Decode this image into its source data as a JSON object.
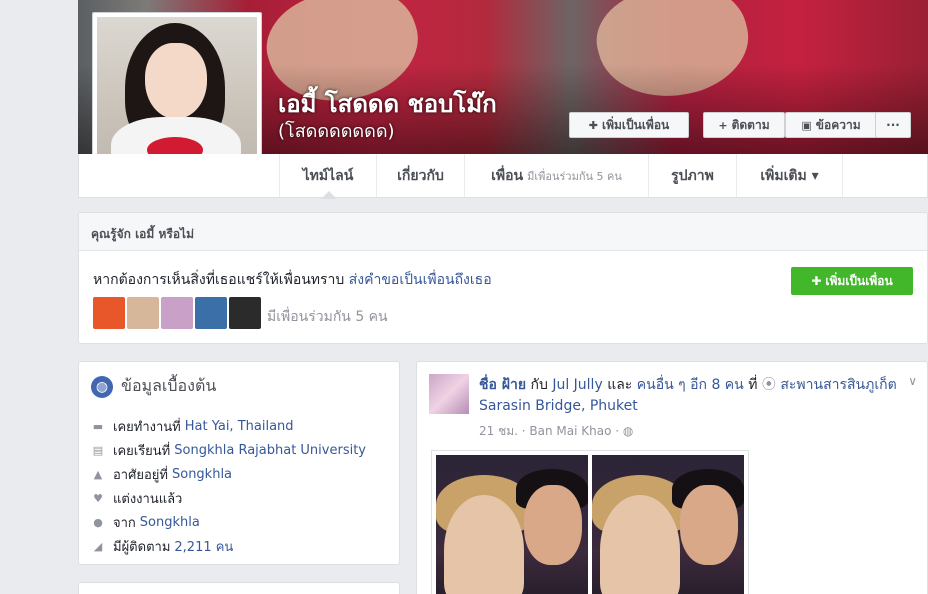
{
  "profile": {
    "name": "เอมี้ โสดดด ชอบโม๊ก",
    "alternate_name": "(โสดดดดดดด)"
  },
  "cover_actions": {
    "add_friend": "เพิ่มเป็นเพื่อน",
    "follow": "ติดตาม",
    "message": "ข้อความ",
    "more": "···"
  },
  "tabs": {
    "timeline": "ไทม์ไลน์",
    "about": "เกี่ยวกับ",
    "friends": "เพื่อน",
    "friends_sub": "มีเพื่อนร่วมกัน 5 คน",
    "photos": "รูปภาพ",
    "more": "เพิ่มเติม ▾"
  },
  "know_box": {
    "header": "คุณรู้จัก เอมี้ หรือไม่",
    "message": "หากต้องการเห็นสิ่งที่เธอแชร์ให้เพื่อนทราบ",
    "message_link": "ส่งคำขอเป็นเพื่อนถึงเธอ",
    "add_button": "เพิ่มเป็นเพื่อน",
    "mutual_text": "มีเพื่อนร่วมกัน 5 คน",
    "thumb_colors": [
      "#e8572a",
      "#d6b79a",
      "#c8a0c8",
      "#3a6fa8",
      "#2b2b2b"
    ]
  },
  "intro": {
    "title": "ข้อมูลเบื้องต้น",
    "rows": [
      {
        "icon": "briefcase-icon",
        "glyph": "▬",
        "label": "เคยทำงานที่",
        "value": "Hat Yai, Thailand"
      },
      {
        "icon": "school-icon",
        "glyph": "▤",
        "label": "เคยเรียนที่",
        "value": "Songkhla Rajabhat University"
      },
      {
        "icon": "home-icon",
        "glyph": "▲",
        "label": "อาศัยอยู่ที่",
        "value": "Songkhla"
      },
      {
        "icon": "heart-icon",
        "glyph": "♥",
        "label": "แต่งงานแล้ว",
        "value": ""
      },
      {
        "icon": "location-pin-icon",
        "glyph": "●",
        "label": "จาก",
        "value": "Songkhla"
      },
      {
        "icon": "rss-icon",
        "glyph": "◢",
        "label": "มีผู้ติดตาม",
        "value": "2,211 คน"
      }
    ]
  },
  "post": {
    "author": "ชื่อ ฝ้าย",
    "with_text": " กับ ",
    "tagged": "Jul Jully",
    "and_text": " และ ",
    "others": "คนอื่น ๆ อีก 8 คน",
    "at_text": " ที่ ",
    "place": "สะพานสารสินภูเก็ต Sarasin Bridge, Phuket",
    "time": "21 ชม.",
    "location": "Ban Mai Khao",
    "sep": " · "
  }
}
